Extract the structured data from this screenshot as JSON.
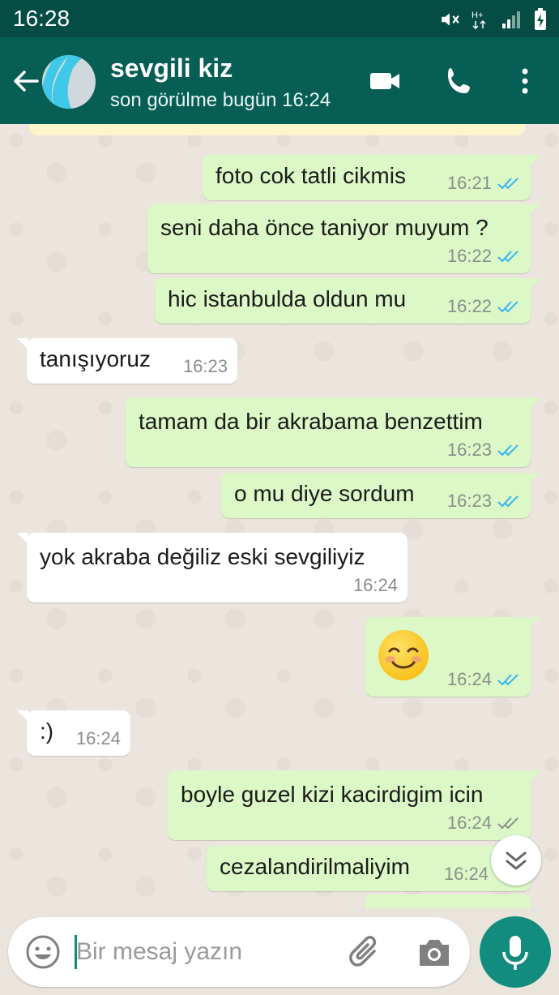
{
  "status_bar": {
    "time": "16:28"
  },
  "header": {
    "contact_name": "sevgili kiz",
    "last_seen": "son görülme bugün 16:24"
  },
  "messages": [
    {
      "dir": "out",
      "text": "foto cok tatli cikmis",
      "time": "16:21",
      "read": true
    },
    {
      "dir": "out",
      "text": "seni daha önce taniyor muyum ?",
      "time": "16:22",
      "read": true
    },
    {
      "dir": "out",
      "text": "hic istanbulda oldun mu",
      "time": "16:22",
      "read": true
    },
    {
      "dir": "in",
      "text": "tanışıyoruz",
      "time": "16:23"
    },
    {
      "dir": "out",
      "text": "tamam da bir akrabama benzettim",
      "time": "16:23",
      "read": true
    },
    {
      "dir": "out",
      "text": "o mu diye sordum",
      "time": "16:23",
      "read": true
    },
    {
      "dir": "in",
      "text": "yok akraba değiliz eski sevgiliyiz",
      "time": "16:24"
    },
    {
      "dir": "out",
      "emoji": "smiling-face-icon",
      "time": "16:24",
      "read": true
    },
    {
      "dir": "in",
      "text": ":)",
      "time": "16:24"
    },
    {
      "dir": "out",
      "text": "boyle guzel kizi kacirdigim icin",
      "time": "16:24",
      "read": false
    },
    {
      "dir": "out",
      "text": "cezalandirilmaliyim",
      "time": "16:24",
      "read": false
    }
  ],
  "composer": {
    "placeholder": "Bir mesaj yazın"
  },
  "colors": {
    "header": "#075e54",
    "status_bar": "#054d44",
    "outgoing_bubble": "#dcf8c6",
    "incoming_bubble": "#ffffff",
    "read_ticks": "#34b7f1",
    "unread_ticks": "#8a8f8a",
    "accent": "#128c7e"
  }
}
